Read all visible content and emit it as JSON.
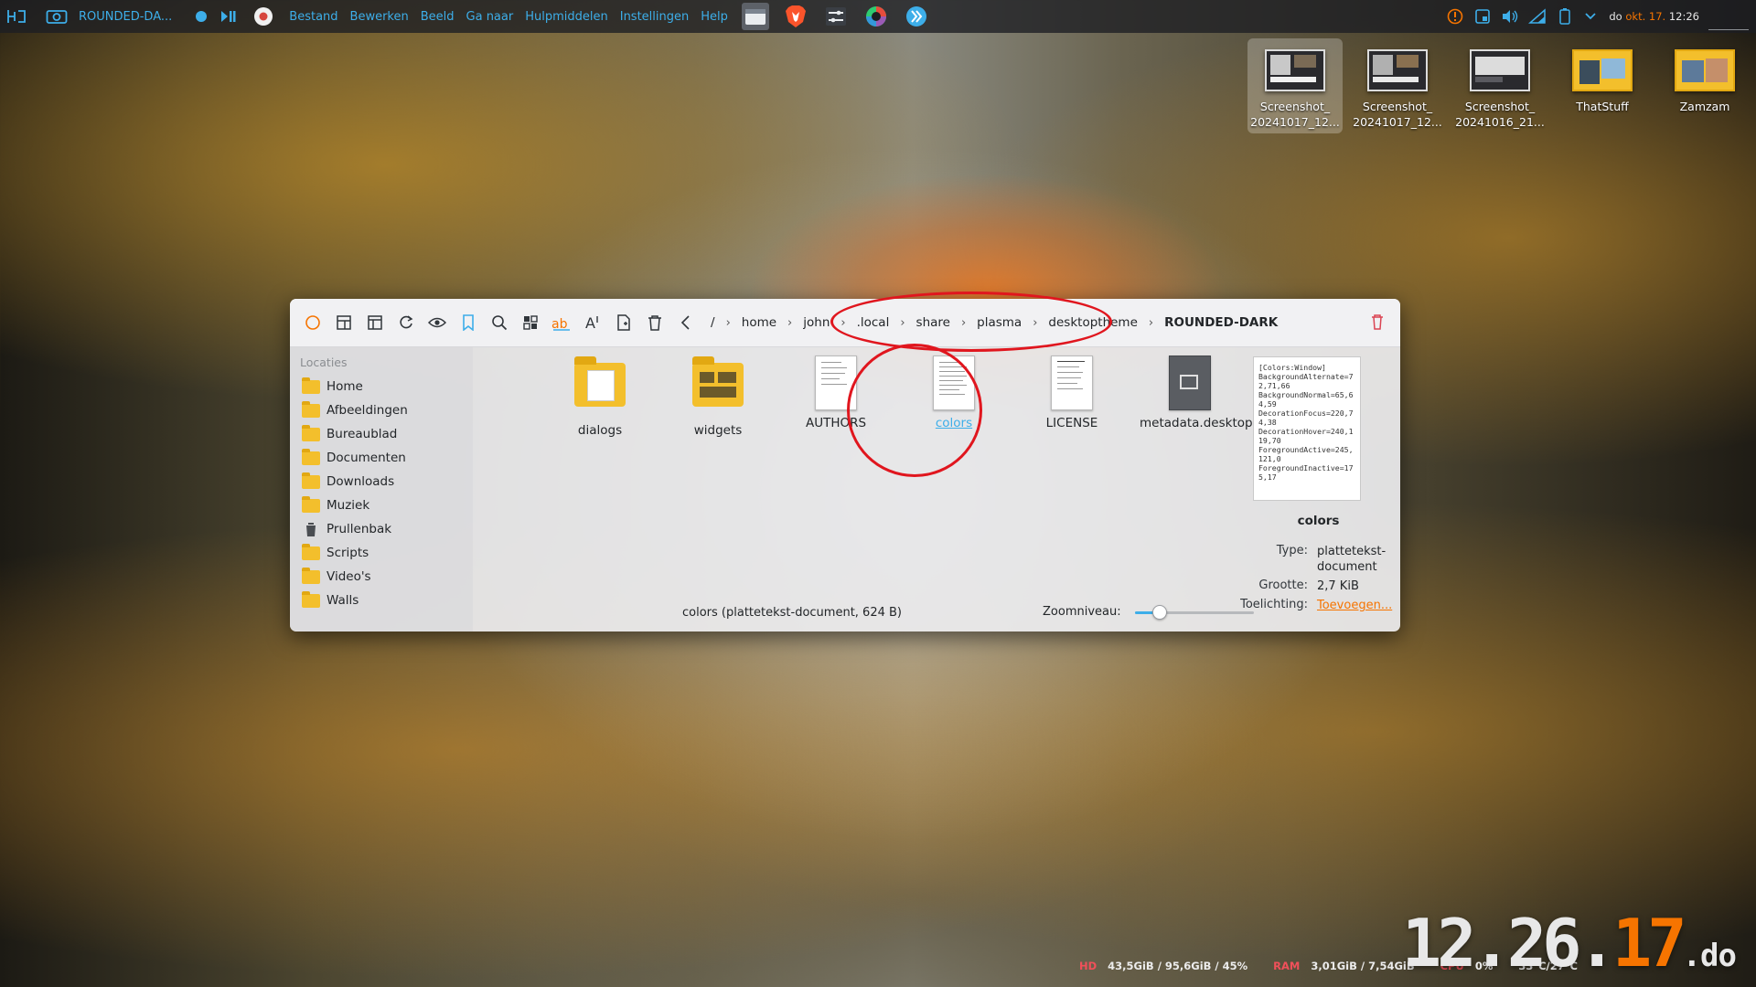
{
  "panel": {
    "window_title": "ROUNDED-DA...",
    "menu": [
      "Bestand",
      "Bewerken",
      "Beeld",
      "Ga naar",
      "Hulpmiddelen",
      "Instellingen",
      "Help"
    ],
    "clock_day": "do",
    "clock_date": "okt. 17.",
    "clock_time": "12:26"
  },
  "desktop_icons": [
    {
      "label": "Screenshot_ 20241017_12...",
      "kind": "screenshot",
      "selected": true
    },
    {
      "label": "Screenshot_ 20241017_12...",
      "kind": "screenshot",
      "selected": false
    },
    {
      "label": "Screenshot_ 20241016_21...",
      "kind": "screenshot",
      "selected": false
    },
    {
      "label": "ThatStuff",
      "kind": "folder-image",
      "selected": false
    },
    {
      "label": "Zamzam",
      "kind": "folder-image",
      "selected": false
    }
  ],
  "window": {
    "breadcrumb": [
      "/",
      "home",
      "john",
      ".local",
      "share",
      "plasma",
      "desktoptheme",
      "ROUNDED-DARK"
    ],
    "sidebar_heading": "Locaties",
    "places": [
      {
        "label": "Home",
        "icon": "home-folder-icon"
      },
      {
        "label": "Afbeeldingen",
        "icon": "pictures-folder-icon"
      },
      {
        "label": "Bureaublad",
        "icon": "desktop-folder-icon"
      },
      {
        "label": "Documenten",
        "icon": "documents-folder-icon"
      },
      {
        "label": "Downloads",
        "icon": "downloads-folder-icon"
      },
      {
        "label": "Muziek",
        "icon": "music-folder-icon"
      },
      {
        "label": "Prullenbak",
        "icon": "trash-icon"
      },
      {
        "label": "Scripts",
        "icon": "scripts-folder-icon"
      },
      {
        "label": "Video's",
        "icon": "videos-folder-icon"
      },
      {
        "label": "Walls",
        "icon": "walls-folder-icon"
      }
    ],
    "files": [
      {
        "name": "dialogs",
        "type": "folder",
        "selected": false
      },
      {
        "name": "widgets",
        "type": "folder",
        "selected": false
      },
      {
        "name": "AUTHORS",
        "type": "text",
        "selected": false
      },
      {
        "name": "colors",
        "type": "text",
        "selected": true
      },
      {
        "name": "LICENSE",
        "type": "text",
        "selected": false
      },
      {
        "name": "metadata.desktop",
        "type": "desktop",
        "selected": false
      }
    ],
    "status_text": "colors (plattetekst-document, 624 B)",
    "zoom_label": "Zoomniveau:",
    "zoom_level": 0.2,
    "info": {
      "preview_text": "[Colors:Window]\nBackgroundAlternate=72,71,66\nBackgroundNormal=65,64,59\nDecorationFocus=220,74,38\nDecorationHover=240,119,70\nForegroundActive=245,121,0\nForegroundInactive=175,17",
      "name": "colors",
      "type_key": "Type:",
      "type_value": "plattetekst- document",
      "size_key": "Grootte:",
      "size_value": "2,7 KiB",
      "comment_key": "Toelichting:",
      "comment_value": "Toevoegen..."
    }
  },
  "system_stats": {
    "hd_label": "HD",
    "hd_value": "43,5GiB / 95,6GiB / 45%",
    "ram_label": "RAM",
    "ram_value": "3,01GiB / 7,54GiB",
    "cpu_label": "CPU",
    "cpu_value": "0%",
    "temp_value": "33°C/27°C"
  },
  "desktop_clock": {
    "hour": "12.",
    "minute": "26.",
    "date": "17",
    "day": ".do"
  }
}
